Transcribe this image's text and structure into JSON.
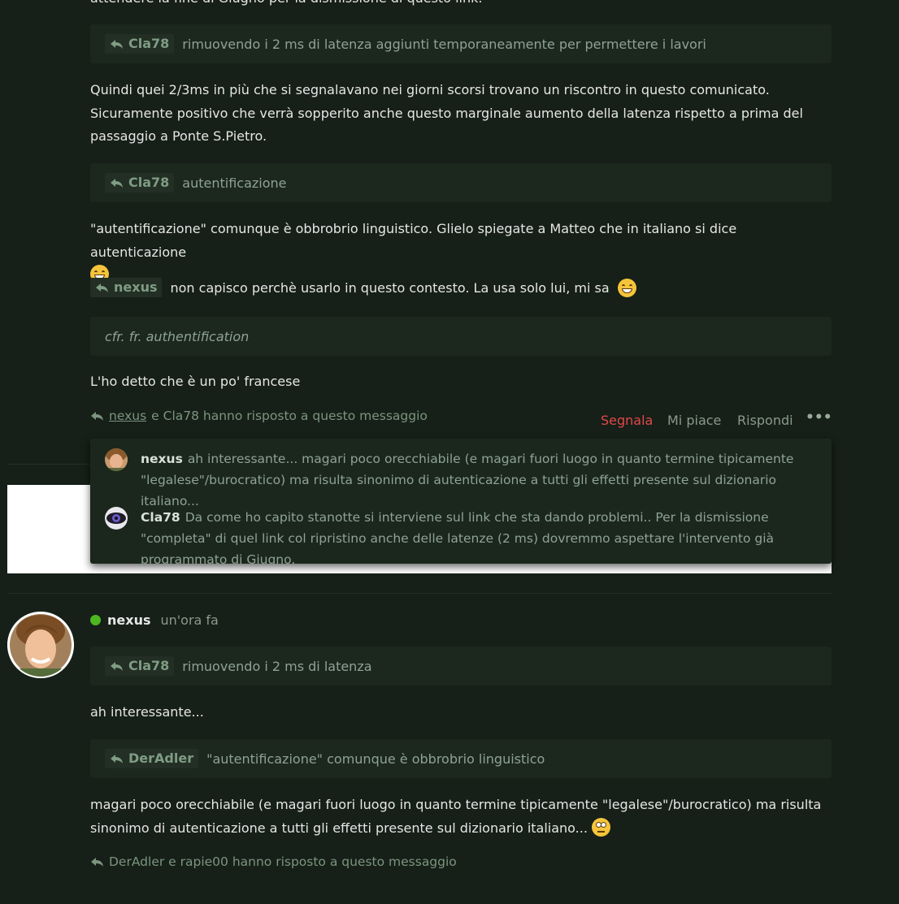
{
  "top_cut_text": "attendere la fine di Giugno per la dismissione di questo link.",
  "quote1": {
    "user": "Cla78",
    "text": "rimuovendo i 2 ms di latenza aggiunti temporaneamente per permettere i lavori"
  },
  "para1": "Quindi quei 2/3ms in più che si segnalavano nei giorni scorsi trovano un riscontro in questo comunicato. Sicuramente positivo che verrà sopperito anche questo marginale aumento della latenza rispetto a prima del passaggio a Ponte S.Pietro.",
  "quote2": {
    "user": "Cla78",
    "text": "autentificazione"
  },
  "para2": "\"autentificazione\" comunque è obbrobrio linguistico. Glielo spiegate a Matteo che in italiano si dice autenticazione",
  "inline_reply": {
    "user": "nexus",
    "text": "non capisco perchè usarlo in questo contesto. La usa solo lui, mi sa"
  },
  "quote3": {
    "text": "cfr. fr. authentification"
  },
  "para3": "L'ho detto che è un po' francese",
  "replied_line1": {
    "user1": "nexus",
    "rest": "e Cla78 hanno risposto a questo messaggio"
  },
  "actions": {
    "report": "Segnala",
    "like": "Mi piace",
    "reply": "Rispondi",
    "more": "•••"
  },
  "popup": {
    "items": [
      {
        "user": "nexus",
        "text": "ah interessante... magari poco orecchiabile (e magari fuori luogo in quanto termine tipicamente \"legalese\"/burocratico) ma risulta sinonimo di autenticazione a tutti gli effetti presente sul dizionario italiano..."
      },
      {
        "user": "Cla78",
        "text": "Da come ho capito stanotte si interviene sul link che sta dando problemi.. Per la dismissione \"completa\" di quel link col ripristino anche delle latenze (2 ms) dovremmo aspettare l'intervento già programmato di Giugno."
      }
    ]
  },
  "post2": {
    "author": "nexus",
    "time": "un'ora fa",
    "quote1": {
      "user": "Cla78",
      "text": "rimuovendo i 2 ms di latenza"
    },
    "para1": "ah interessante...",
    "quote2": {
      "user": "DerAdler",
      "text": "\"autentificazione\" comunque è obbrobrio linguistico"
    },
    "para2": "magari poco orecchiabile (e magari fuori luogo in quanto termine tipicamente \"legalese\"/burocratico) ma risulta sinonimo di autenticazione a tutti gli effetti presente sul dizionario italiano...",
    "replied_line": "DerAdler e rapie00 hanno risposto a questo messaggio"
  },
  "colors": {
    "background": "#161f18",
    "quote_bg": "#1c271e",
    "online": "#4cb71f",
    "report": "#e04848",
    "muted": "#8ea393"
  }
}
